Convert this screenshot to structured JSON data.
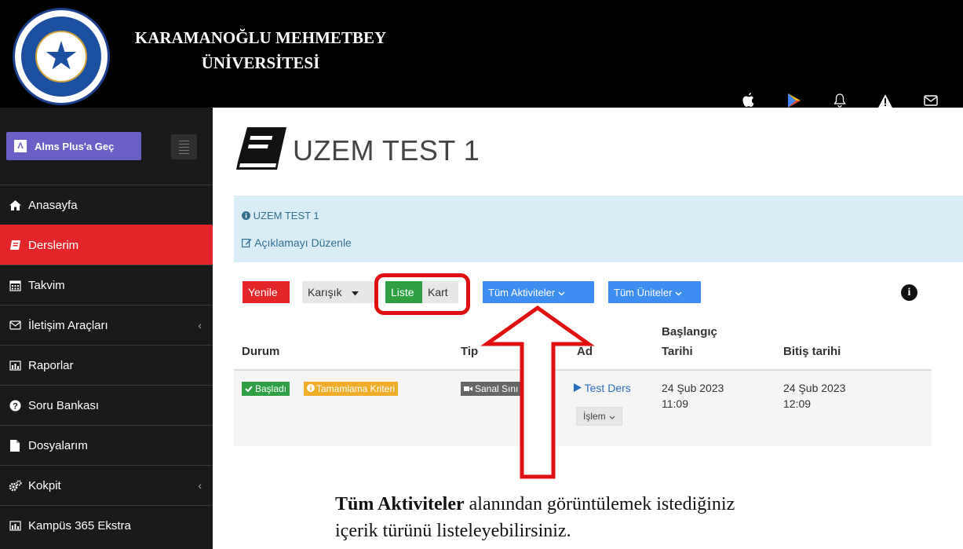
{
  "header": {
    "university_line1": "KARAMANOĞLU MEHMETBEY",
    "university_line2": "ÜNİVERSİTESİ",
    "icons": [
      "apple-icon",
      "play-store-icon",
      "bell-icon",
      "warning-icon",
      "mail-icon"
    ]
  },
  "sidebar": {
    "plus_button": "Alms Plus'a Geç",
    "items": [
      {
        "label": "Anasayfa",
        "icon": "home-icon"
      },
      {
        "label": "Derslerim",
        "icon": "book-icon",
        "active": true
      },
      {
        "label": "Takvim",
        "icon": "calendar-icon"
      },
      {
        "label": "İletişim Araçları",
        "icon": "mail-icon",
        "has_children": true
      },
      {
        "label": "Raporlar",
        "icon": "chart-icon"
      },
      {
        "label": "Soru Bankası",
        "icon": "question-icon"
      },
      {
        "label": "Dosyalarım",
        "icon": "file-icon"
      },
      {
        "label": "Kokpit",
        "icon": "gears-icon",
        "has_children": true
      },
      {
        "label": "Kampüs 365 Ekstra",
        "icon": "chart-icon"
      }
    ],
    "chevron": "‹"
  },
  "main": {
    "title": "UZEM TEST 1",
    "info": {
      "name": "UZEM TEST 1",
      "edit_link": "Açıklamayı Düzenle"
    },
    "toolbar": {
      "refresh": "Yenile",
      "sort": "Karışık",
      "view_list": "Liste",
      "view_card": "Kart",
      "activities": "Tüm Aktiviteler",
      "units": "Tüm Üniteler"
    },
    "table": {
      "headers": {
        "status": "Durum",
        "type": "Tip",
        "name": "Ad",
        "start_line1": "Başlangıç",
        "start_line2": "Tarihi",
        "end": "Bitiş tarihi"
      },
      "rows": [
        {
          "status_badge": "Başladı",
          "criteria_badge": "Tamamlama Kriteri",
          "type": "Sanal Sını",
          "name": "Test Ders",
          "action": "İşlem",
          "start_date": "24 Şub 2023",
          "start_time": "11:09",
          "end_date": "24 Şub 2023",
          "end_time": "12:09"
        }
      ]
    }
  },
  "annotation": {
    "caption_bold": "Tüm Aktiviteler",
    "caption_rest_line1": " alanından görüntülemek istediğiniz",
    "caption_line2": "içerik türünü listeleyebilirsiniz.",
    "color": "#e01010"
  },
  "colors": {
    "header_bg": "#000000",
    "sidebar_bg": "#1a1a1a",
    "active": "#e4262b",
    "info_bg": "#d9edf7",
    "plus_button": "#6a5fc4",
    "blue_button": "#3d8ef0",
    "green": "#2ea043",
    "orange": "#f0ad2a"
  }
}
